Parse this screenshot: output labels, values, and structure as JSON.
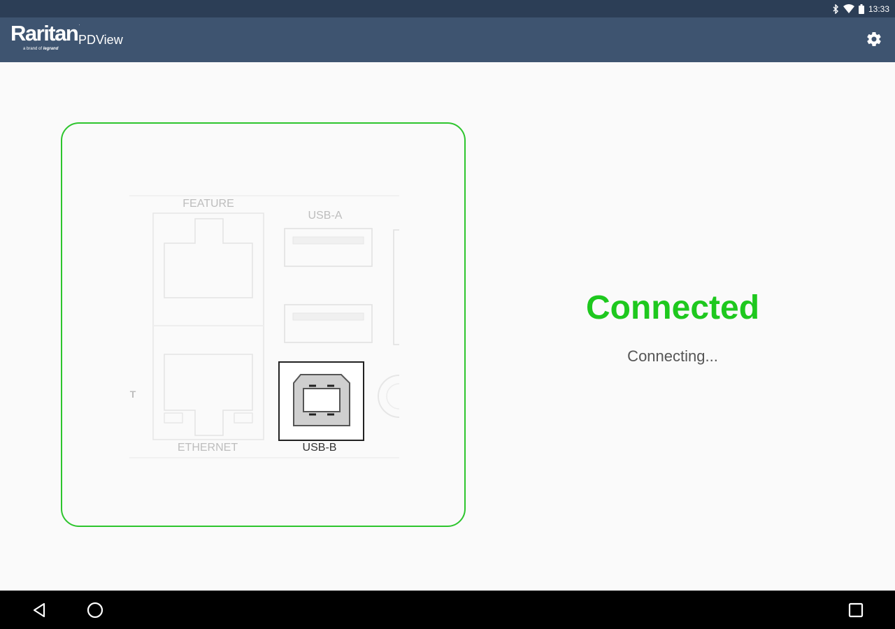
{
  "status_bar": {
    "time": "13:33",
    "icons": [
      "bluetooth-icon",
      "wifi-icon",
      "battery-icon"
    ]
  },
  "app_bar": {
    "logo_text": "Raritan",
    "logo_reg": ".",
    "logo_tagline": "a brand of",
    "logo_tagline_brand": "legrand",
    "app_name": "PDView",
    "settings_icon": "gear-icon"
  },
  "device_panel": {
    "feature_label": "FEATURE",
    "usb_a_label": "USB-A",
    "ethernet_label": "ETHERNET",
    "usb_b_label": "USB-B",
    "side_marker": "T",
    "highlight_color": "#2dc52d"
  },
  "connection": {
    "status": "Connected",
    "message": "Connecting...",
    "status_color": "#1ec81e"
  },
  "nav_bar": {
    "icons": [
      "back-icon",
      "home-icon",
      "recents-icon"
    ]
  }
}
